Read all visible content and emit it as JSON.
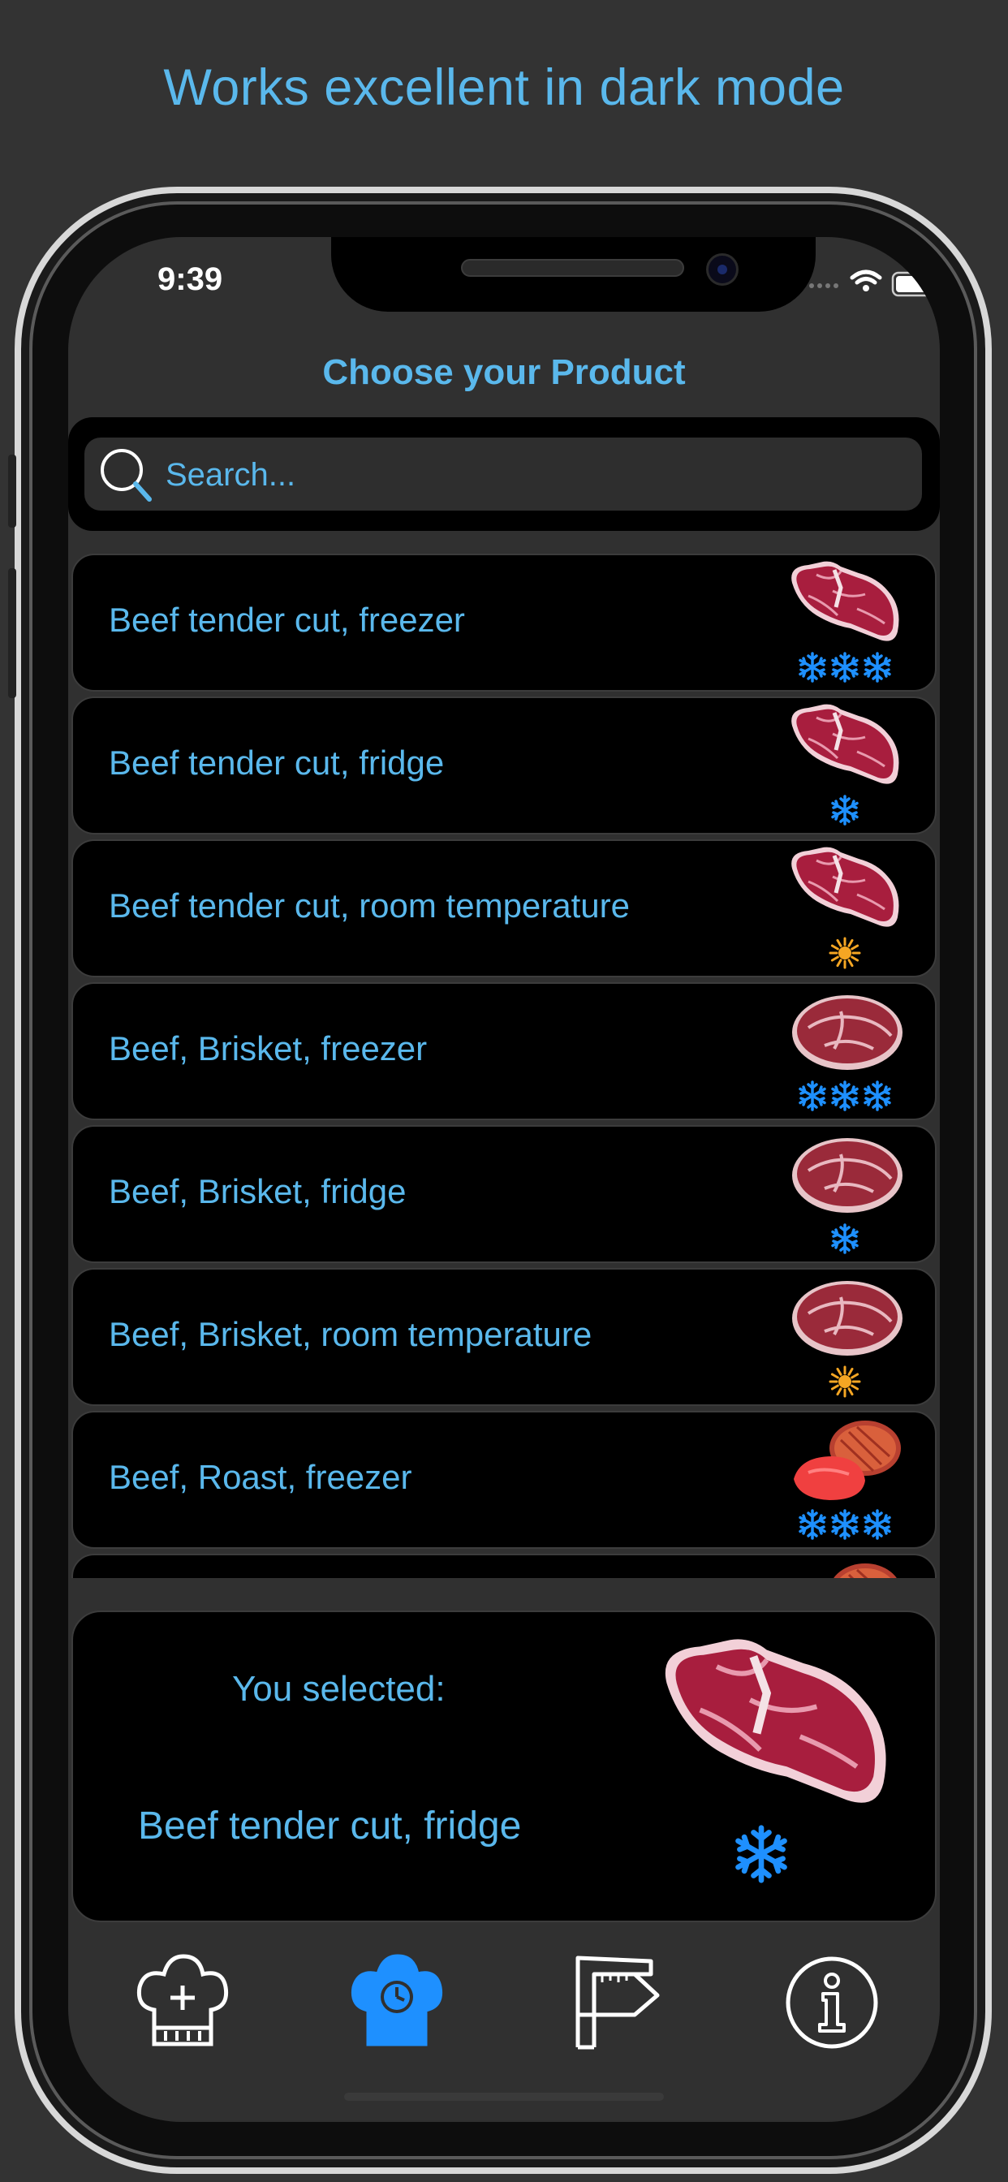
{
  "headline": "Works excellent in dark mode",
  "status_bar": {
    "time": "9:39"
  },
  "nav": {
    "title": "Choose your Product"
  },
  "search": {
    "placeholder": "Search..."
  },
  "products": [
    {
      "label": "Beef tender cut, freezer",
      "image": "t-bone-steak",
      "storage": "freezer"
    },
    {
      "label": "Beef tender cut, fridge",
      "image": "t-bone-steak",
      "storage": "fridge"
    },
    {
      "label": "Beef tender cut, room temperature",
      "image": "t-bone-steak",
      "storage": "room"
    },
    {
      "label": "Beef, Brisket, freezer",
      "image": "brisket",
      "storage": "freezer"
    },
    {
      "label": "Beef, Brisket, fridge",
      "image": "brisket",
      "storage": "fridge"
    },
    {
      "label": "Beef, Brisket, room temperature",
      "image": "brisket",
      "storage": "room"
    },
    {
      "label": "Beef, Roast, freezer",
      "image": "roast",
      "storage": "freezer"
    },
    {
      "label": "",
      "image": "roast",
      "storage": "fridge"
    }
  ],
  "selection": {
    "caption": "You selected:",
    "value": "Beef tender cut, fridge",
    "image": "t-bone-steak",
    "storage": "fridge"
  },
  "tabbar": {
    "tabs": [
      {
        "icon": "chef-hat-add-icon",
        "active": false
      },
      {
        "icon": "chef-hat-timer-icon",
        "active": true
      },
      {
        "icon": "caliper-icon",
        "active": false
      },
      {
        "icon": "info-icon",
        "active": false
      }
    ]
  },
  "colors": {
    "accent": "#5ab8ec",
    "background": "#333333",
    "row_background": "#000000",
    "freezer_icon": "#1e90ff",
    "room_icon": "#f5a623",
    "tab_active": "#1e90ff",
    "tab_inactive": "#ffffff"
  }
}
